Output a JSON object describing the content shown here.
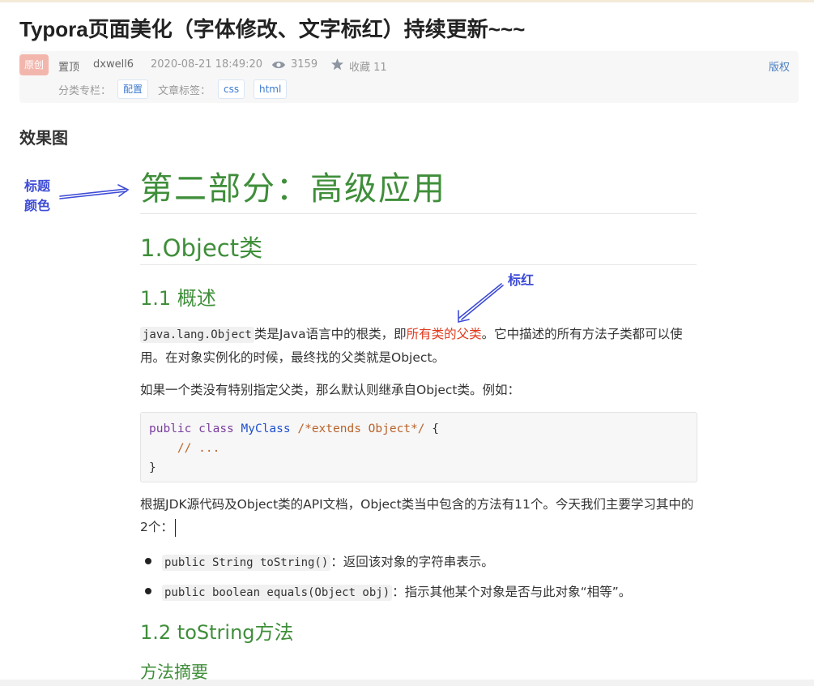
{
  "article": {
    "title": "Typora页面美化（字体修改、文字标红）持续更新~~~",
    "meta": {
      "badge": "原创",
      "pinned": "置顶",
      "author": "dxwell6",
      "date": "2020-08-21 18:49:20",
      "views": "3159",
      "favorites": "收藏 11",
      "copyright": "版权",
      "category_label": "分类专栏：",
      "category": "配置",
      "tags_label": "文章标签：",
      "tags": [
        "css",
        "html"
      ]
    },
    "section_heading": "效果图"
  },
  "annotations": {
    "title_color_line1": "标题",
    "title_color_line2": "颜色",
    "mark_red": "标红"
  },
  "doc": {
    "h1": "第二部分：高级应用",
    "h2": "1.Object类",
    "h3": "1.1 概述",
    "p1": {
      "code": "java.lang.Object",
      "before_red": "类是Java语言中的根类，即",
      "red": "所有类的父类",
      "after_red": "。它中描述的所有方法子类都可以使用。在对象实例化的时候，最终找的父类就是Object。"
    },
    "p2": "如果一个类没有特别指定父类，那么默认则继承自Object类。例如：",
    "code_block": {
      "kw1": "public",
      "kw2": "class",
      "classname": "MyClass",
      "comment": "/*extends Object*/",
      "brace_open": "{",
      "body_comment": "// ...",
      "brace_close": "}"
    },
    "p3": "根据JDK源代码及Object类的API文档，Object类当中包含的方法有11个。今天我们主要学习其中的2个：",
    "bullets": [
      {
        "code": "public String toString()",
        "text": "：返回该对象的字符串表示。"
      },
      {
        "code": "public boolean equals(Object obj)",
        "text": "：指示其他某个对象是否与此对象“相等”。"
      }
    ],
    "h4": "1.2 toString方法",
    "h5": "方法摘要"
  },
  "colors": {
    "heading_green": "#3f8e3a",
    "annotation_blue": "#3d4bd6",
    "highlight_red": "#e03a1e",
    "badge_pink": "#f3b6ad"
  }
}
